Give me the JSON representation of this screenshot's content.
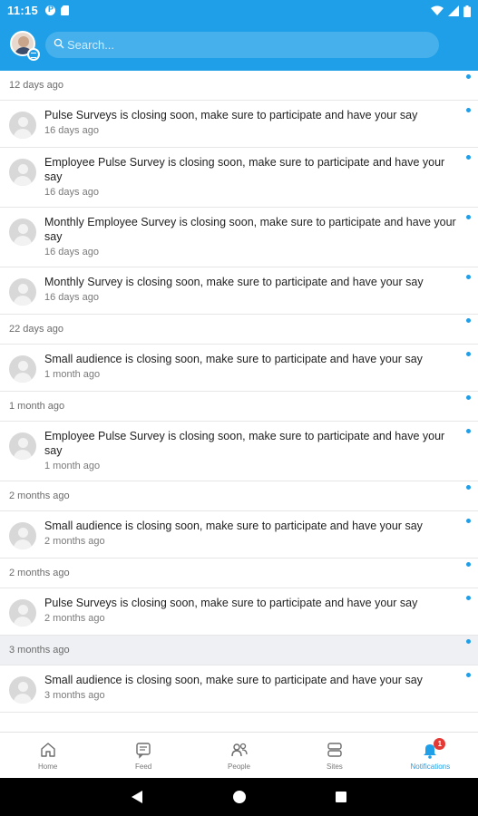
{
  "status_bar": {
    "time": "11:15"
  },
  "search": {
    "placeholder": "Search..."
  },
  "groups": [
    {
      "header": "12 days ago",
      "shaded": false,
      "items": [
        {
          "text": "Pulse Surveys is closing soon, make sure to participate and have your say",
          "time": "16 days ago"
        },
        {
          "text": "Employee Pulse Survey is closing soon, make sure to participate and have your say",
          "time": "16 days ago"
        },
        {
          "text": "Monthly Employee Survey is closing soon, make sure to participate and have your say",
          "time": "16 days ago"
        },
        {
          "text": "Monthly Survey is closing soon, make sure to participate and have your say",
          "time": "16 days ago"
        }
      ]
    },
    {
      "header": "22 days ago",
      "shaded": false,
      "items": [
        {
          "text": "Small audience is closing soon, make sure to participate and have your say",
          "time": "1 month ago"
        }
      ]
    },
    {
      "header": "1 month ago",
      "shaded": false,
      "items": [
        {
          "text": "Employee Pulse Survey is closing soon, make sure to participate and have your say",
          "time": "1 month ago"
        }
      ]
    },
    {
      "header": "2 months ago",
      "shaded": false,
      "items": [
        {
          "text": "Small audience is closing soon, make sure to participate and have your say",
          "time": "2 months ago"
        }
      ]
    },
    {
      "header": "2 months ago",
      "shaded": false,
      "items": [
        {
          "text": "Pulse Surveys is closing soon, make sure to participate and have your say",
          "time": "2 months ago"
        }
      ]
    },
    {
      "header": "3 months ago",
      "shaded": true,
      "items": [
        {
          "text": "Small audience is closing soon, make sure to participate and have your say",
          "time": "3 months ago"
        }
      ]
    }
  ],
  "bottom_nav": [
    {
      "label": "Home",
      "icon": "home-icon",
      "active": false
    },
    {
      "label": "Feed",
      "icon": "feed-icon",
      "active": false
    },
    {
      "label": "People",
      "icon": "people-icon",
      "active": false
    },
    {
      "label": "Sites",
      "icon": "sites-icon",
      "active": false
    },
    {
      "label": "Notifications",
      "icon": "bell-icon",
      "active": true,
      "badge": "1"
    }
  ],
  "colors": {
    "accent": "#1e9fe8",
    "badge": "#e53935"
  }
}
